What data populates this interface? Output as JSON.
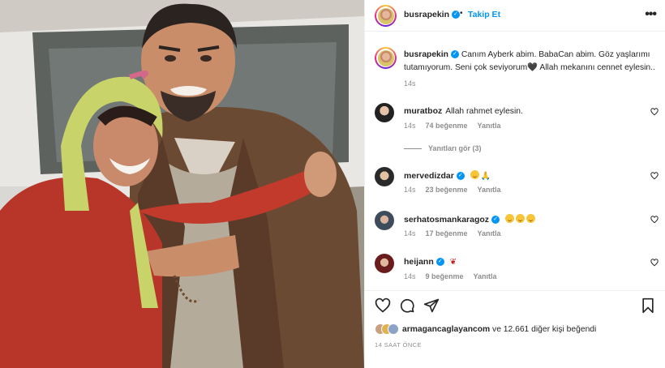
{
  "header": {
    "username": "busrapekin",
    "follow_label": "Takip Et",
    "separator": "•",
    "more_icon": "more-horizontal-icon"
  },
  "caption": {
    "username": "busrapekin",
    "text": "Canım Ayberk abim. BabaCan abim. Göz yaşlarımı tutamıyorum. Seni çok seviyorum🖤 Allah mekanını cennet eylesin..",
    "time": "14s"
  },
  "comments": [
    {
      "username": "muratboz",
      "verified": false,
      "text": "Allah rahmet eylesin.",
      "time": "14s",
      "likes": "74 beğenme",
      "reply": "Yanıtla"
    },
    {
      "username": "mervedizdar",
      "verified": true,
      "text": "",
      "time": "14s",
      "likes": "23 beğenme",
      "reply": "Yanıtla"
    },
    {
      "username": "serhatosmankaragoz",
      "verified": true,
      "text": "",
      "time": "14s",
      "likes": "17 beğenme",
      "reply": "Yanıtla"
    },
    {
      "username": "heijann",
      "verified": true,
      "text": "",
      "time": "14s",
      "likes": "9 beğenme",
      "reply": "Yanıtla"
    }
  ],
  "view_replies": "Yanıtları gör (3)",
  "likes": {
    "user": "armagancaglayancom",
    "rest": "ve 12.661 diğer kişi",
    "suffix": "beğendi"
  },
  "date": "14 SAAT ÖNCE",
  "colors": {
    "accent": "#0095f6",
    "muted": "#8e8e8e",
    "text": "#262626"
  }
}
